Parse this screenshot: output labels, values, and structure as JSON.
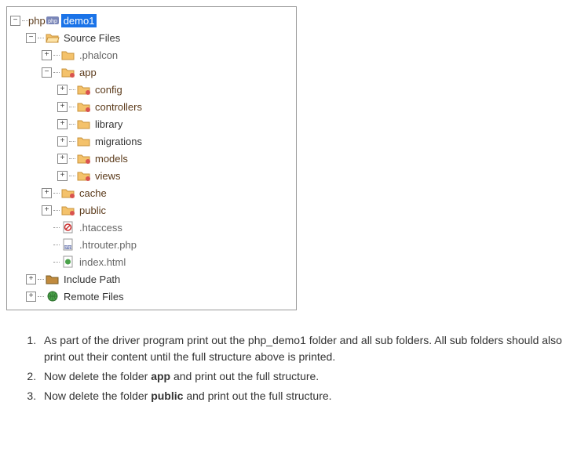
{
  "tree": [
    {
      "id": "root",
      "depth": 0,
      "toggle": "minus",
      "icon": "php",
      "label": "demo1",
      "selected": true,
      "accent": false,
      "grey": false
    },
    {
      "id": "src",
      "depth": 1,
      "toggle": "minus",
      "icon": "folder-open",
      "label": "Source Files",
      "selected": false,
      "accent": false,
      "grey": false
    },
    {
      "id": "phalcon",
      "depth": 2,
      "toggle": "plus",
      "icon": "folder",
      "label": ".phalcon",
      "selected": false,
      "accent": false,
      "grey": true
    },
    {
      "id": "app",
      "depth": 2,
      "toggle": "minus",
      "icon": "folder-badge",
      "label": "app",
      "selected": false,
      "accent": true,
      "grey": false
    },
    {
      "id": "config",
      "depth": 3,
      "toggle": "plus",
      "icon": "folder-badge",
      "label": "config",
      "selected": false,
      "accent": true,
      "grey": false
    },
    {
      "id": "controllers",
      "depth": 3,
      "toggle": "plus",
      "icon": "folder-badge",
      "label": "controllers",
      "selected": false,
      "accent": true,
      "grey": false
    },
    {
      "id": "library",
      "depth": 3,
      "toggle": "plus",
      "icon": "folder",
      "label": "library",
      "selected": false,
      "accent": false,
      "grey": false
    },
    {
      "id": "migrations",
      "depth": 3,
      "toggle": "plus",
      "icon": "folder",
      "label": "migrations",
      "selected": false,
      "accent": false,
      "grey": false
    },
    {
      "id": "models",
      "depth": 3,
      "toggle": "plus",
      "icon": "folder-badge",
      "label": "models",
      "selected": false,
      "accent": true,
      "grey": false
    },
    {
      "id": "views",
      "depth": 3,
      "toggle": "plus",
      "icon": "folder-badge",
      "label": "views",
      "selected": false,
      "accent": true,
      "grey": false
    },
    {
      "id": "cache",
      "depth": 2,
      "toggle": "plus",
      "icon": "folder-badge",
      "label": "cache",
      "selected": false,
      "accent": true,
      "grey": false
    },
    {
      "id": "public",
      "depth": 2,
      "toggle": "plus",
      "icon": "folder-badge",
      "label": "public",
      "selected": false,
      "accent": true,
      "grey": false
    },
    {
      "id": "htaccess",
      "depth": 2,
      "toggle": "none",
      "icon": "file-block",
      "label": ".htaccess",
      "selected": false,
      "accent": false,
      "grey": true
    },
    {
      "id": "htrouter",
      "depth": 2,
      "toggle": "none",
      "icon": "file-php",
      "label": ".htrouter.php",
      "selected": false,
      "accent": false,
      "grey": true
    },
    {
      "id": "indexhtml",
      "depth": 2,
      "toggle": "none",
      "icon": "file-html",
      "label": "index.html",
      "selected": false,
      "accent": false,
      "grey": true
    },
    {
      "id": "include",
      "depth": 1,
      "toggle": "plus",
      "icon": "folder-dark",
      "label": "Include Path",
      "selected": false,
      "accent": false,
      "grey": false
    },
    {
      "id": "remote",
      "depth": 1,
      "toggle": "plus",
      "icon": "globe",
      "label": "Remote Files",
      "selected": false,
      "accent": false,
      "grey": false
    }
  ],
  "rootPrefix": "php",
  "instructions": {
    "item1_a": "As part of the driver program print out the php_demo1 folder and all sub folders. All sub folders should also print out their content until the full structure above is printed.",
    "item2_a": "Now delete the folder ",
    "item2_bold": "app",
    "item2_b": " and print out the full structure.",
    "item3_a": "Now delete the folder ",
    "item3_bold": "public",
    "item3_b": " and print out the full structure."
  }
}
